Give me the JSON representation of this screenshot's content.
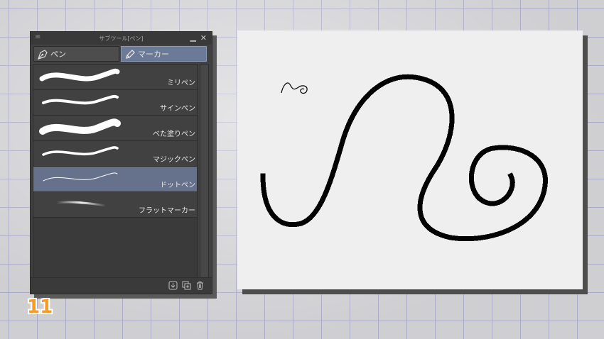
{
  "panel": {
    "title": "サブツール[ペン]",
    "menu_icon": "hamburger-icon",
    "minimize_icon": "minimize-icon",
    "close_icon": "close-icon",
    "tabs": [
      {
        "label": "ペン",
        "icon": "pen-nib-icon",
        "selected": false
      },
      {
        "label": "マーカー",
        "icon": "marker-icon",
        "selected": true
      }
    ],
    "brushes": [
      {
        "label": "ミリペン",
        "selected": false
      },
      {
        "label": "サインペン",
        "selected": false
      },
      {
        "label": "べた塗りペン",
        "selected": false
      },
      {
        "label": "マジックペン",
        "selected": false
      },
      {
        "label": "ドットペン",
        "selected": true
      },
      {
        "label": "フラットマーカー",
        "selected": false
      }
    ],
    "footer_icons": [
      "save-subtool-icon",
      "duplicate-subtool-icon",
      "delete-subtool-icon"
    ]
  },
  "colors": {
    "panel_bg": "#414141",
    "selected_bg": "#66728c",
    "canvas_bg": "#efefef",
    "stroke": "#000000",
    "badge": "#ff9a1f"
  },
  "step_badge": "11"
}
